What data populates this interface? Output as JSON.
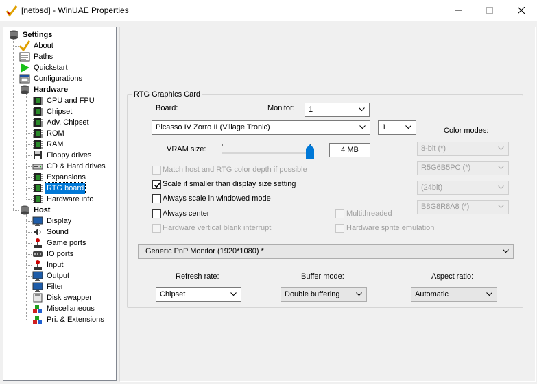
{
  "window": {
    "title": "[netbsd] - WinUAE Properties"
  },
  "tree": {
    "items": [
      {
        "label": "Settings",
        "icon": "settings-drive-icon"
      },
      {
        "label": "About",
        "icon": "checkmark-icon"
      },
      {
        "label": "Paths",
        "icon": "paths-icon"
      },
      {
        "label": "Quickstart",
        "icon": "play-arrow-icon"
      },
      {
        "label": "Configurations",
        "icon": "config-window-icon"
      },
      {
        "label": "Hardware",
        "icon": "hardware-drive-icon"
      },
      {
        "label": "CPU and FPU",
        "icon": "chip-icon"
      },
      {
        "label": "Chipset",
        "icon": "chip-icon"
      },
      {
        "label": "Adv. Chipset",
        "icon": "chip-icon"
      },
      {
        "label": "ROM",
        "icon": "chip-icon"
      },
      {
        "label": "RAM",
        "icon": "chip-icon"
      },
      {
        "label": "Floppy drives",
        "icon": "floppy-icon"
      },
      {
        "label": "CD & Hard drives",
        "icon": "drive-icon"
      },
      {
        "label": "Expansions",
        "icon": "chip-icon"
      },
      {
        "label": "RTG board",
        "icon": "rtg-board-icon"
      },
      {
        "label": "Hardware info",
        "icon": "chip-icon"
      },
      {
        "label": "Host",
        "icon": "host-drive-icon"
      },
      {
        "label": "Display",
        "icon": "monitor-icon"
      },
      {
        "label": "Sound",
        "icon": "speaker-icon"
      },
      {
        "label": "Game ports",
        "icon": "joystick-icon"
      },
      {
        "label": "IO ports",
        "icon": "io-port-icon"
      },
      {
        "label": "Input",
        "icon": "joystick-icon"
      },
      {
        "label": "Output",
        "icon": "monitor-icon"
      },
      {
        "label": "Filter",
        "icon": "monitor-icon"
      },
      {
        "label": "Disk swapper",
        "icon": "disk-icon"
      },
      {
        "label": "Miscellaneous",
        "icon": "cubes-icon"
      },
      {
        "label": "Pri. & Extensions",
        "icon": "cubes-icon"
      }
    ],
    "selected": "RTG board"
  },
  "rtg": {
    "group_title": "RTG Graphics Card",
    "board_label": "Board:",
    "monitor_label": "Monitor:",
    "monitor_value": "1",
    "board_value": "Picasso IV Zorro II (Village Tronic)",
    "board_count": "1",
    "color_modes_label": "Color modes:",
    "color_modes": [
      "8-bit (*)",
      "R5G6B5PC (*)",
      "(24bit)",
      "B8G8R8A8 (*)"
    ],
    "vram_label": "VRAM size:",
    "vram_value": "4 MB",
    "vram_fraction": 0.96,
    "options": {
      "match_depth": "Match host and RTG color depth if possible",
      "scale_smaller": "Scale if smaller than display size setting",
      "always_scale": "Always scale in windowed mode",
      "always_center": "Always center",
      "vblank": "Hardware vertical blank interrupt",
      "multithreaded": "Multithreaded",
      "hw_sprite": "Hardware sprite emulation"
    },
    "display_value": "Generic PnP Monitor (1920*1080) *",
    "refresh_label": "Refresh rate:",
    "refresh_value": "Chipset",
    "buffer_label": "Buffer mode:",
    "buffer_value": "Double buffering",
    "aspect_label": "Aspect ratio:",
    "aspect_value": "Automatic"
  },
  "colors": {
    "selection": "#0078d7",
    "accent": "#0078d7"
  }
}
